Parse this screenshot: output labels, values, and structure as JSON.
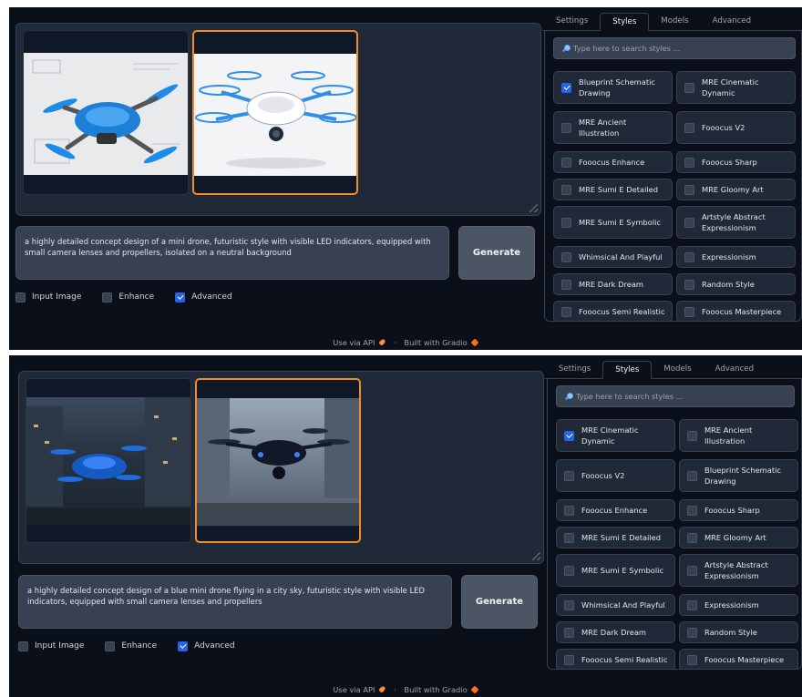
{
  "footer": {
    "api_label": "Use via API",
    "separator": "·",
    "built_label": "Built with Gradio"
  },
  "tabs": [
    "Settings",
    "Styles",
    "Models",
    "Advanced"
  ],
  "search_placeholder": "Type here to search styles ...",
  "options": {
    "input_image": "Input Image",
    "enhance": "Enhance",
    "advanced": "Advanced"
  },
  "generate_label": "Generate",
  "colors": {
    "accent_blue": "#2563eb",
    "selected_border": "#f28c28",
    "background": "#0b0f19"
  },
  "screens": [
    {
      "prompt": "a highly detailed concept design of a mini drone, futuristic style with visible LED indicators, equipped with small camera lenses and propellers, isolated on a neutral background",
      "styles": [
        {
          "label": "Blueprint Schematic Drawing",
          "checked": true
        },
        {
          "label": "MRE Cinematic Dynamic",
          "checked": false
        },
        {
          "label": "MRE Ancient Illustration",
          "checked": false
        },
        {
          "label": "Fooocus V2",
          "checked": false
        },
        {
          "label": "Fooocus Enhance",
          "checked": false
        },
        {
          "label": "Fooocus Sharp",
          "checked": false
        },
        {
          "label": "MRE Sumi E Detailed",
          "checked": false
        },
        {
          "label": "MRE Gloomy Art",
          "checked": false
        },
        {
          "label": "MRE Sumi E Symbolic",
          "checked": false
        },
        {
          "label": "Artstyle Abstract Expressionism",
          "checked": false
        },
        {
          "label": "Whimsical And Playful",
          "checked": false
        },
        {
          "label": "Expressionism",
          "checked": false
        },
        {
          "label": "MRE Dark Dream",
          "checked": false
        },
        {
          "label": "Random Style",
          "checked": false
        },
        {
          "label": "Fooocus Semi Realistic",
          "checked": false
        },
        {
          "label": "Fooocus Masterpiece",
          "checked": false
        }
      ]
    },
    {
      "prompt": "a highly detailed concept design of a blue mini drone flying in a city sky, futuristic style with visible LED indicators, equipped with small camera lenses and propellers",
      "styles": [
        {
          "label": "MRE Cinematic Dynamic",
          "checked": true
        },
        {
          "label": "MRE Ancient Illustration",
          "checked": false
        },
        {
          "label": "Fooocus V2",
          "checked": false
        },
        {
          "label": "Blueprint Schematic Drawing",
          "checked": false
        },
        {
          "label": "Fooocus Enhance",
          "checked": false
        },
        {
          "label": "Fooocus Sharp",
          "checked": false
        },
        {
          "label": "MRE Sumi E Detailed",
          "checked": false
        },
        {
          "label": "MRE Gloomy Art",
          "checked": false
        },
        {
          "label": "MRE Sumi E Symbolic",
          "checked": false
        },
        {
          "label": "Artstyle Abstract Expressionism",
          "checked": false
        },
        {
          "label": "Whimsical And Playful",
          "checked": false
        },
        {
          "label": "Expressionism",
          "checked": false
        },
        {
          "label": "MRE Dark Dream",
          "checked": false
        },
        {
          "label": "Random Style",
          "checked": false
        },
        {
          "label": "Fooocus Semi Realistic",
          "checked": false
        },
        {
          "label": "Fooocus Masterpiece",
          "checked": false
        }
      ]
    }
  ]
}
